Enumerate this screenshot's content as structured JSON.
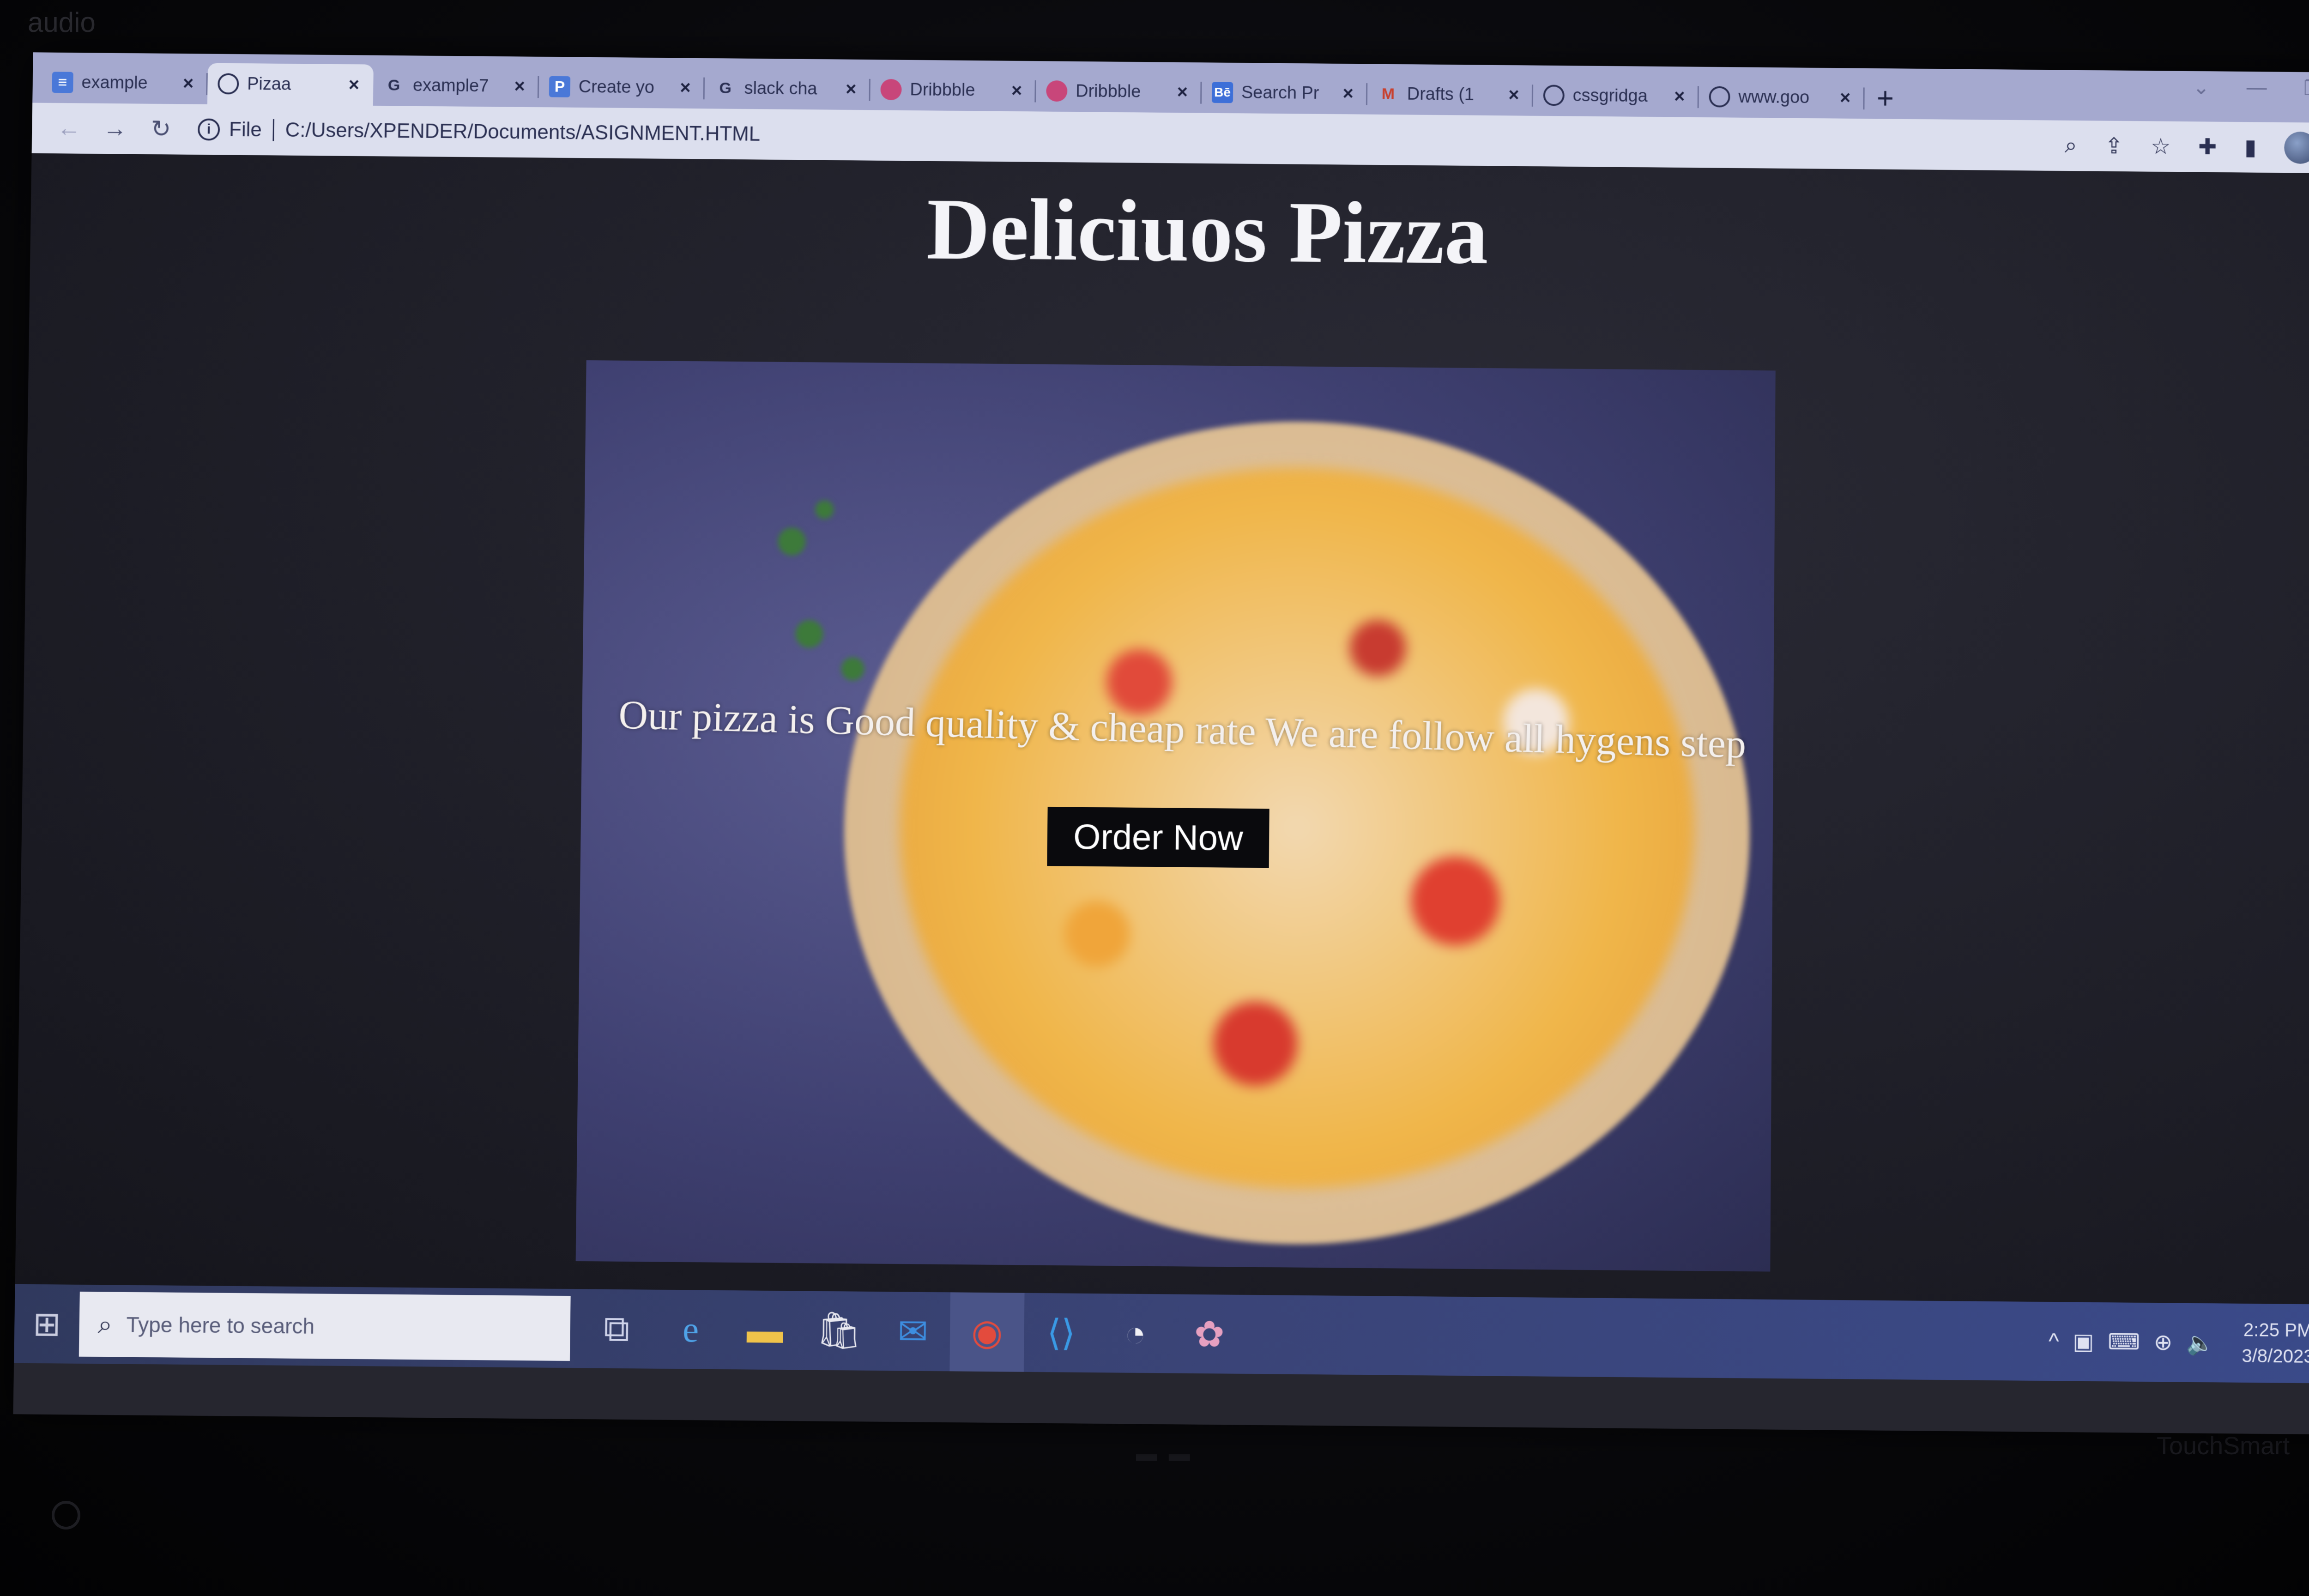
{
  "bezel": {
    "brand": "audio",
    "model": "TouchSmart"
  },
  "browser": {
    "tabs": [
      {
        "label": "example",
        "icon": "doc-icon",
        "active": false
      },
      {
        "label": "Pizaa",
        "icon": "globe-icon",
        "active": true
      },
      {
        "label": "example7",
        "icon": "google-icon",
        "active": false
      },
      {
        "label": "Create yo",
        "icon": "p-icon",
        "active": false
      },
      {
        "label": "slack cha",
        "icon": "google-icon",
        "active": false
      },
      {
        "label": "Dribbble",
        "icon": "dribbble-icon",
        "active": false
      },
      {
        "label": "Dribbble",
        "icon": "dribbble-icon",
        "active": false
      },
      {
        "label": "Search Pr",
        "icon": "behance-icon",
        "active": false
      },
      {
        "label": "Drafts (1",
        "icon": "gmail-icon",
        "active": false
      },
      {
        "label": "cssgridga",
        "icon": "globe-icon",
        "active": false
      },
      {
        "label": "www.goo",
        "icon": "globe-icon",
        "active": false
      }
    ],
    "tab_close": "×",
    "new_tab": "+",
    "address": {
      "scheme": "File",
      "url": "C:/Users/XPENDER/Documents/ASIGNMENT.HTML"
    }
  },
  "page": {
    "title": "Deliciuos Pizza",
    "tagline": "Our pizza is Good quality & cheap rate We are follow all hygens step",
    "cta": "Order Now"
  },
  "taskbar": {
    "search_placeholder": "Type here to search",
    "time": "2:25 PM",
    "date": "3/8/2023"
  },
  "colors": {
    "tabstrip": "#a5a9cf",
    "toolbar": "#dcdfee",
    "page_bg": "#1e1e27",
    "cta_bg": "#0a0a0d",
    "taskbar": "#3a4477"
  }
}
